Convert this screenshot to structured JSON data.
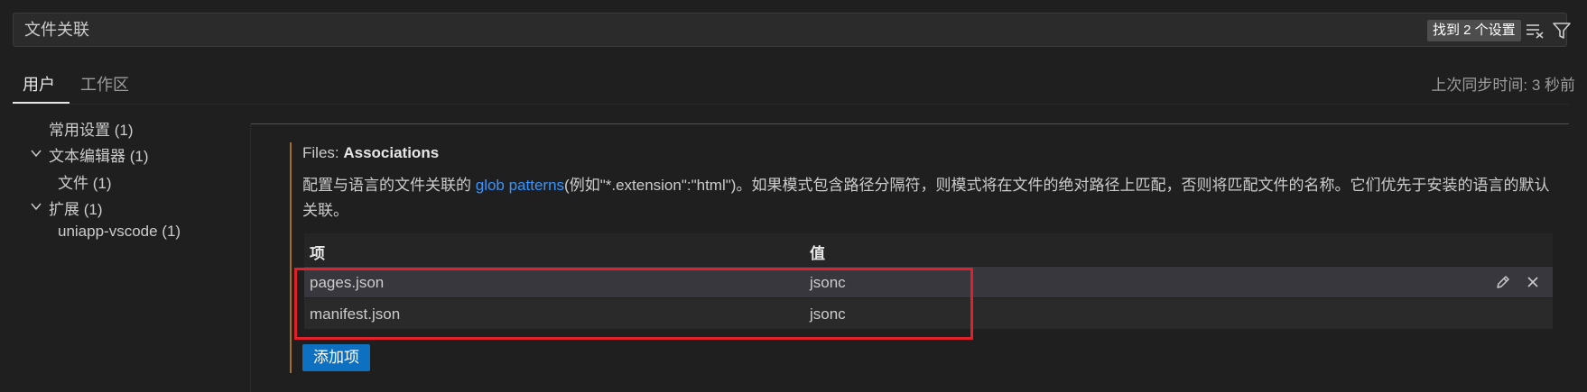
{
  "search": {
    "value": "文件关联",
    "result_badge": "找到 2 个设置"
  },
  "tabs": [
    {
      "label": "用户",
      "active": true
    },
    {
      "label": "工作区",
      "active": false
    }
  ],
  "sync_status": "上次同步时间: 3 秒前",
  "toc": [
    {
      "label": "常用设置 (1)",
      "level": 0,
      "expanded": null
    },
    {
      "label": "文本编辑器 (1)",
      "level": 0,
      "expanded": true
    },
    {
      "label": "文件 (1)",
      "level": 1,
      "expanded": null
    },
    {
      "label": "扩展 (1)",
      "level": 0,
      "expanded": true
    },
    {
      "label": "uniapp-vscode (1)",
      "level": 1,
      "expanded": null
    }
  ],
  "setting": {
    "category": "Files: ",
    "name": "Associations",
    "desc_prefix": "配置与语言的文件关联的 ",
    "desc_link": "glob patterns",
    "desc_suffix": "(例如\"*.extension\":\"html\")。如果模式包含路径分隔符，则模式将在文件的绝对路径上匹配，否则将匹配文件的名称。它们优先于安装的语言的默认关联。",
    "table": {
      "header_key": "项",
      "header_value": "值",
      "rows": [
        {
          "key": "pages.json",
          "value": "jsonc"
        },
        {
          "key": "manifest.json",
          "value": "jsonc"
        }
      ]
    },
    "add_button": "添加项"
  },
  "colors": {
    "background": "#1f1f1f",
    "accent_blue": "#0e70c0",
    "link": "#3794ff",
    "highlight_red": "#e0202a",
    "modified_indicator": "#a07028"
  }
}
